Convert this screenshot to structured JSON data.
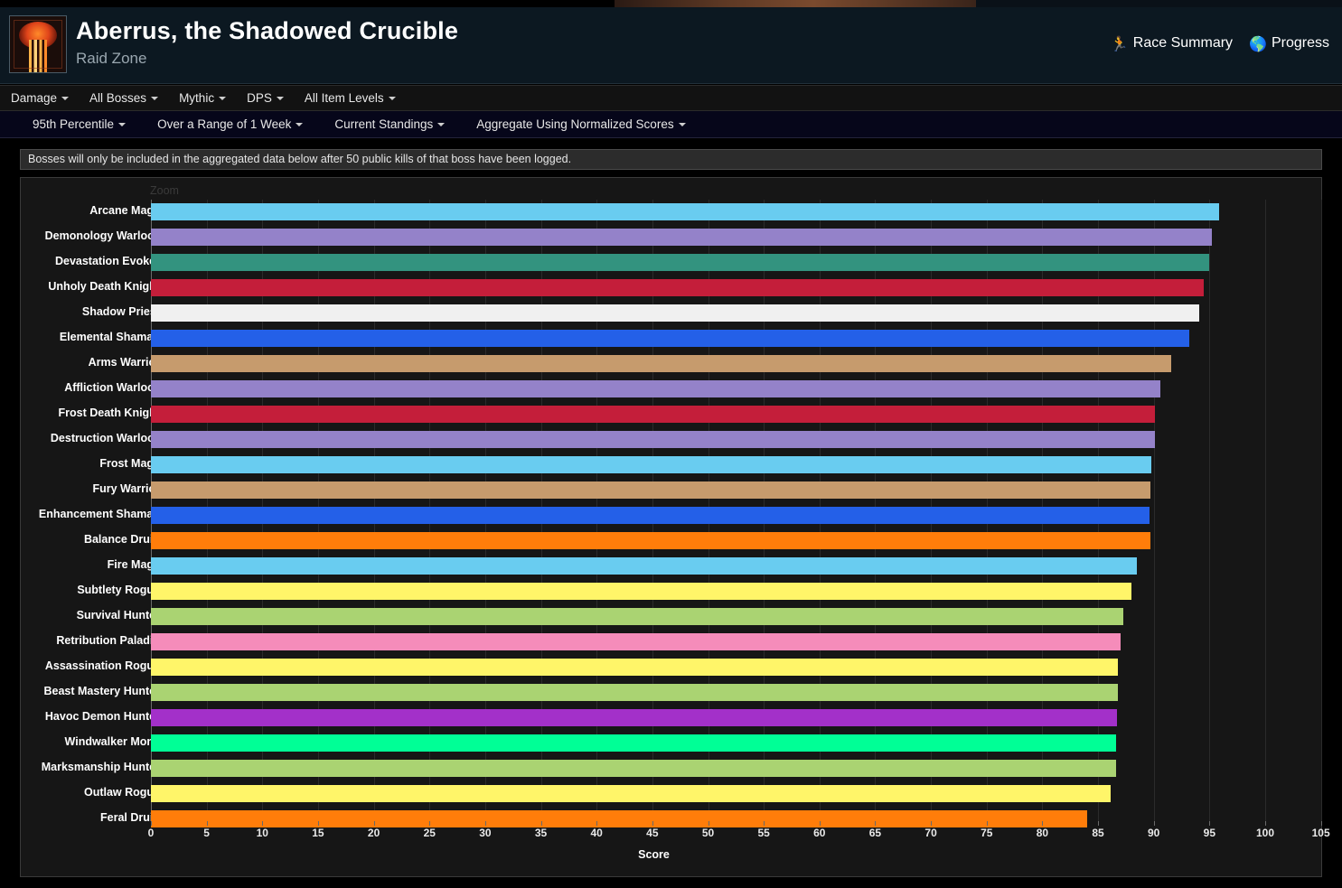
{
  "header": {
    "title": "Aberrus, the Shadowed Crucible",
    "subtitle": "Raid Zone",
    "zone_icon": "raid-zone-icon",
    "links": [
      {
        "label": "Race Summary",
        "icon": "running-person-icon",
        "glyph": "🏃"
      },
      {
        "label": "Progress",
        "icon": "globe-icon",
        "glyph": "🌐"
      }
    ]
  },
  "menubar": [
    {
      "label": "Damage"
    },
    {
      "label": "All Bosses"
    },
    {
      "label": "Mythic"
    },
    {
      "label": "DPS"
    },
    {
      "label": "All Item Levels"
    }
  ],
  "filterbar": [
    {
      "label": "95th Percentile"
    },
    {
      "label": "Over a Range of 1 Week"
    },
    {
      "label": "Current Standings"
    },
    {
      "label": "Aggregate Using Normalized Scores"
    }
  ],
  "notice": "Bosses will only be included in the aggregated data below after 50 public kills of that boss have been logged.",
  "chart_zoom_label": "Zoom",
  "chart_data": {
    "type": "bar",
    "orientation": "horizontal",
    "title": "",
    "xlabel": "Score",
    "ylabel": "",
    "xlim": [
      0,
      105
    ],
    "xticks": [
      0,
      5,
      10,
      15,
      20,
      25,
      30,
      35,
      40,
      45,
      50,
      55,
      60,
      65,
      70,
      75,
      80,
      85,
      90,
      95,
      100,
      105
    ],
    "grid": true,
    "legend": "none",
    "categories": [
      "Arcane Mage",
      "Demonology Warlock",
      "Devastation Evoker",
      "Unholy Death Knight",
      "Shadow Priest",
      "Elemental Shaman",
      "Arms Warrior",
      "Affliction Warlock",
      "Frost Death Knight",
      "Destruction Warlock",
      "Frost Mage",
      "Fury Warrior",
      "Enhancement Shaman",
      "Balance Druid",
      "Fire Mage",
      "Subtlety Rogue",
      "Survival Hunter",
      "Retribution Paladin",
      "Assassination Rogue",
      "Beast Mastery Hunter",
      "Havoc Demon Hunter",
      "Windwalker Monk",
      "Marksmanship Hunter",
      "Outlaw Rogue",
      "Feral Druid"
    ],
    "values": [
      95.9,
      95.2,
      95.0,
      94.5,
      94.1,
      93.2,
      91.6,
      90.6,
      90.1,
      90.1,
      89.8,
      89.7,
      89.6,
      89.7,
      88.5,
      88.0,
      87.3,
      87.0,
      86.8,
      86.8,
      86.7,
      86.6,
      86.6,
      86.1,
      84.0
    ],
    "colors": [
      "#69ccf0",
      "#9482c9",
      "#33937f",
      "#c41e3a",
      "#f0f0f0",
      "#2460e8",
      "#c69b6d",
      "#9482c9",
      "#c41e3a",
      "#9482c9",
      "#69ccf0",
      "#c69b6d",
      "#2460e8",
      "#ff7d0a",
      "#69ccf0",
      "#fff569",
      "#aad372",
      "#f58cba",
      "#fff569",
      "#aad372",
      "#a330c9",
      "#00ff96",
      "#aad372",
      "#fff569",
      "#ff7d0a"
    ]
  }
}
